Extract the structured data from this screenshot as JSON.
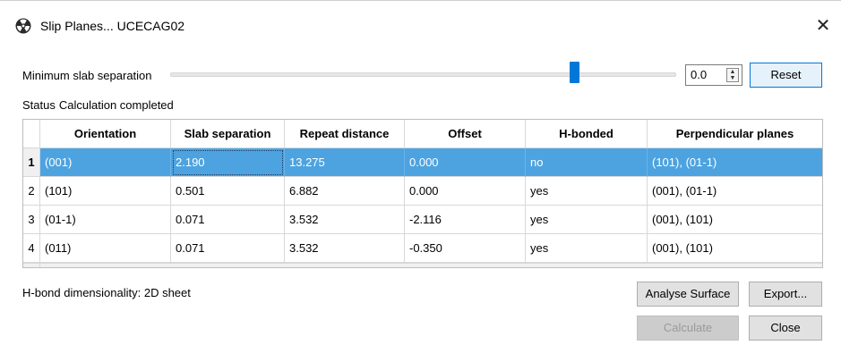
{
  "window": {
    "title": "Slip Planes... UCECAG02",
    "close_glyph": "✕",
    "app_icon": "radiation-trefoil-icon"
  },
  "slider": {
    "label": "Minimum slab separation",
    "value": "0.0",
    "position_fraction": 0.79
  },
  "reset_label": "Reset",
  "status": {
    "label": "Status",
    "text": "Calculation completed"
  },
  "table": {
    "columns": [
      "Orientation",
      "Slab separation",
      "Repeat distance",
      "Offset",
      "H-bonded",
      "Perpendicular planes"
    ],
    "rows": [
      {
        "num": "1",
        "cells": [
          "(001)",
          "2.190",
          "13.275",
          "0.000",
          "no",
          "(101), (01-1)"
        ]
      },
      {
        "num": "2",
        "cells": [
          "(101)",
          "0.501",
          "6.882",
          "0.000",
          "yes",
          "(001), (01-1)"
        ]
      },
      {
        "num": "3",
        "cells": [
          "(01-1)",
          "0.071",
          "3.532",
          "-2.116",
          "yes",
          "(001), (101)"
        ]
      },
      {
        "num": "4",
        "cells": [
          "(011)",
          "0.071",
          "3.532",
          "-0.350",
          "yes",
          "(001), (101)"
        ]
      }
    ],
    "selected_row": 0
  },
  "hbond_text": "H-bond dimensionality: 2D sheet",
  "buttons": {
    "analyse": "Analyse Surface",
    "export": "Export...",
    "calculate": "Calculate",
    "close": "Close"
  },
  "colors": {
    "accent": "#0078d7",
    "selection": "#4da3e0"
  }
}
